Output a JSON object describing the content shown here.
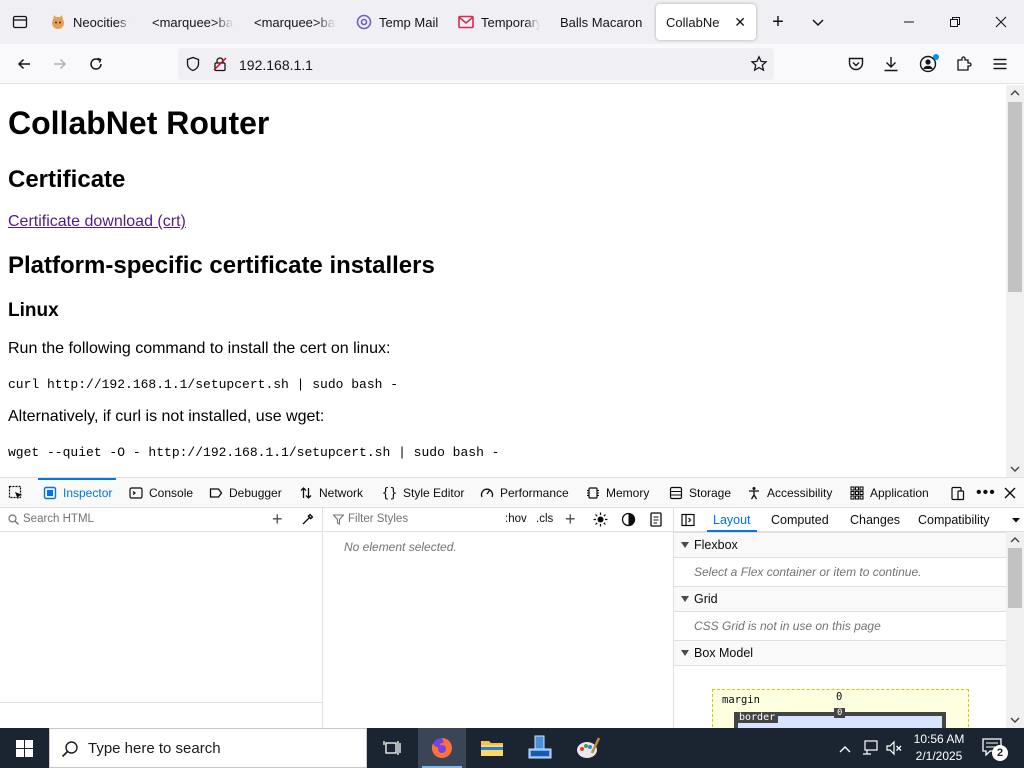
{
  "browser": {
    "tabs": [
      {
        "title": "Neocities -",
        "favicon": "cat-icon"
      },
      {
        "title": "<marquee>ball",
        "favicon": "none"
      },
      {
        "title": "<marquee>ball",
        "favicon": "none"
      },
      {
        "title": "Temp Mail",
        "favicon": "at-sign-icon"
      },
      {
        "title": "Temporary",
        "favicon": "mail-envelope-icon"
      },
      {
        "title": "Balls Macaroni",
        "favicon": "none"
      },
      {
        "title": "CollabNet",
        "favicon": "none",
        "active": true
      }
    ],
    "url": "192.168.1.1",
    "accent": "#0074e8"
  },
  "page": {
    "title": "CollabNet Router",
    "certificate_heading": "Certificate",
    "certificate_link": "Certificate download (crt)",
    "installers_heading": "Platform-specific certificate installers",
    "linux_heading": "Linux",
    "run_text": "Run the following command to install the cert on linux:",
    "curl_cmd": "curl http://192.168.1.1/setupcert.sh | sudo bash -",
    "alt_text": "Alternatively, if curl is not installed, use wget:",
    "wget_cmd": "wget --quiet -O - http://192.168.1.1/setupcert.sh | sudo bash -"
  },
  "devtools": {
    "tabs": [
      "Inspector",
      "Console",
      "Debugger",
      "Network",
      "Style Editor",
      "Performance",
      "Memory",
      "Storage",
      "Accessibility",
      "Application"
    ],
    "search_html_placeholder": "Search HTML",
    "filter_styles_placeholder": "Filter Styles",
    "hov": ":hov",
    "cls": ".cls",
    "no_element": "No element selected.",
    "right_tabs": [
      "Layout",
      "Computed",
      "Changes",
      "Compatibility"
    ],
    "flexbox_heading": "Flexbox",
    "flexbox_msg": "Select a Flex container or item to continue.",
    "grid_heading": "Grid",
    "grid_msg": "CSS Grid is not in use on this page",
    "boxmodel_heading": "Box Model",
    "margin_label": "margin",
    "margin_value": "0",
    "border_label": "border",
    "border_value": "0"
  },
  "taskbar": {
    "search_placeholder": "Type here to search",
    "time": "10:56 AM",
    "date": "2/1/2025",
    "notification_count": "2"
  }
}
